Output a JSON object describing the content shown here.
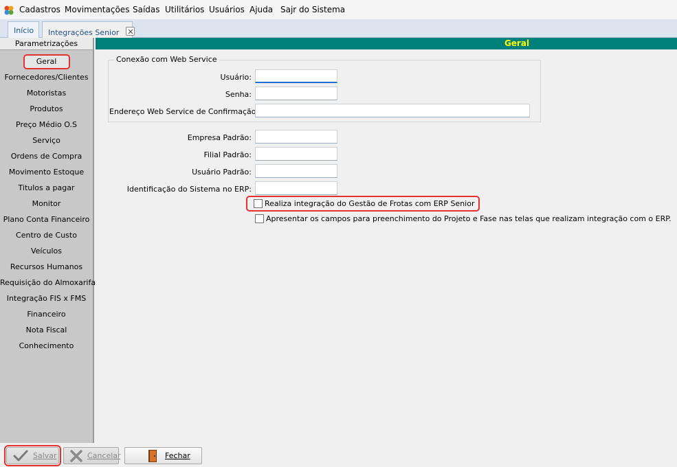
{
  "menubar": {
    "items": [
      {
        "label": "Cadastros"
      },
      {
        "label": "Movimentações"
      },
      {
        "label": "Saídas"
      },
      {
        "label": "Utilitários"
      },
      {
        "label": "Usuários"
      },
      {
        "label": "Ajuda"
      },
      {
        "label": "Sajr do Sistema"
      }
    ]
  },
  "tabs": [
    {
      "label": "Início"
    },
    {
      "label": "Integrações Senior"
    }
  ],
  "sidebar": {
    "header": "Parametrizações",
    "selected": "Geral",
    "items": [
      {
        "label": "Geral"
      },
      {
        "label": "Fornecedores/Clientes"
      },
      {
        "label": "Motoristas"
      },
      {
        "label": "Produtos"
      },
      {
        "label": "Preço Médio O.S"
      },
      {
        "label": "Serviço"
      },
      {
        "label": "Ordens de Compra"
      },
      {
        "label": "Movimento Estoque"
      },
      {
        "label": "Titulos a pagar"
      },
      {
        "label": "Monitor"
      },
      {
        "label": "Plano Conta Financeiro"
      },
      {
        "label": "Centro de Custo"
      },
      {
        "label": "Veículos"
      },
      {
        "label": "Recursos Humanos"
      },
      {
        "label": "Requisição do Almoxarifado"
      },
      {
        "label": "Integração FIS x FMS"
      },
      {
        "label": "Financeiro"
      },
      {
        "label": "Nota Fiscal"
      },
      {
        "label": "Conhecimento"
      }
    ]
  },
  "main": {
    "title": "Geral",
    "webservice": {
      "group_title": "Conexão com Web Service",
      "usuario_label": "Usuário:",
      "usuario_value": "",
      "senha_label": "Senha:",
      "senha_value": "",
      "endereco_label": "Endereço Web Service de Confirmação:",
      "endereco_value": ""
    },
    "empresa_label": "Empresa Padrão:",
    "empresa_value": "",
    "filial_label": "Filial Padrão:",
    "filial_value": "",
    "usuario_padrao_label": "Usuário Padrão:",
    "usuario_padrao_value": "",
    "identificacao_label": "Identificação do Sistema no ERP:",
    "identificacao_value": "",
    "check_integracao": {
      "label": "Realiza integração do Gestão de Frotas com ERP Senior",
      "checked": false
    },
    "check_projeto": {
      "label": "Apresentar os campos para preenchimento do Projeto e Fase nas telas que realizam integração com o ERP.",
      "checked": false
    }
  },
  "toolbar": {
    "salvar_label": "Salvar",
    "cancelar_label": "Cancelar",
    "fechar_label": "Fechar"
  },
  "colors": {
    "header_bg": "#00807a",
    "header_text": "#ffff00",
    "highlight": "#e53030"
  }
}
